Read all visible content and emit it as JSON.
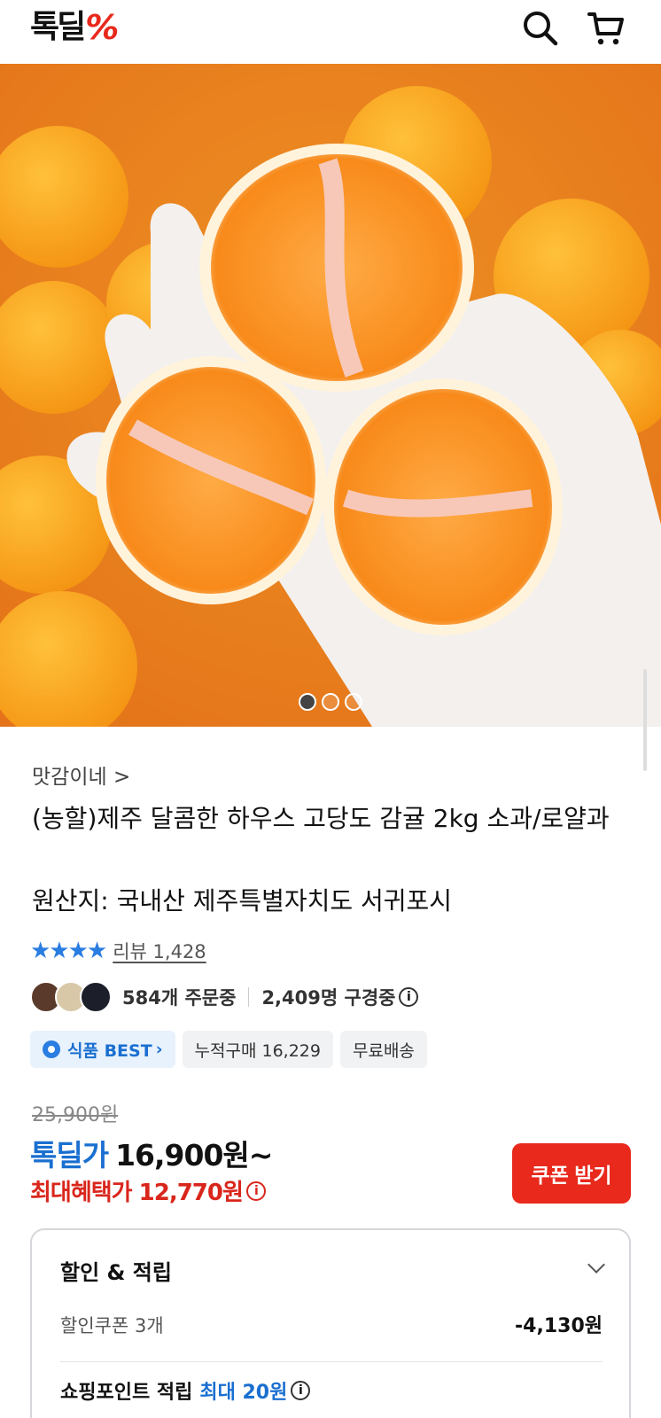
{
  "header": {
    "logo_text": "톡딜",
    "logo_mark": "%",
    "search_icon": "search-icon",
    "cart_icon": "cart-icon"
  },
  "gallery": {
    "image_subject": "peeled tangerine halves in gloved hand",
    "slide_count": 3,
    "active_slide": 1
  },
  "product": {
    "seller": "맛감이네 >",
    "title": "(농할)제주 달콤한 하우스 고당도 감귤 2kg 소과/로얄과",
    "origin": "원산지: 국내산 제주특별자치도 서귀포시",
    "stars": "★★★★",
    "review_label": "리뷰 1,428",
    "rating": 4
  },
  "social": {
    "orders": "584개 주문중",
    "watchers": "2,409명 구경중",
    "info_icon": "ⓘ"
  },
  "tags": {
    "best": "식품 BEST",
    "cumulative": "누적구매 16,229",
    "shipping": "무료배송"
  },
  "price": {
    "original": "25,900원",
    "deal_label": "톡딜가",
    "deal_price": "16,900원~",
    "max_benefit": "최대혜택가 12,770원",
    "coupon_button": "쿠폰 받기"
  },
  "benefit": {
    "title": "할인 & 적립",
    "coupon_label": "할인쿠폰 3개",
    "coupon_amount": "-4,130원",
    "points_label": "쇼핑포인트 적립",
    "points_max": "최대 20원"
  },
  "colors": {
    "accent_red": "#e8291c",
    "accent_blue": "#1a6fd0",
    "star_blue": "#2a7de1"
  }
}
